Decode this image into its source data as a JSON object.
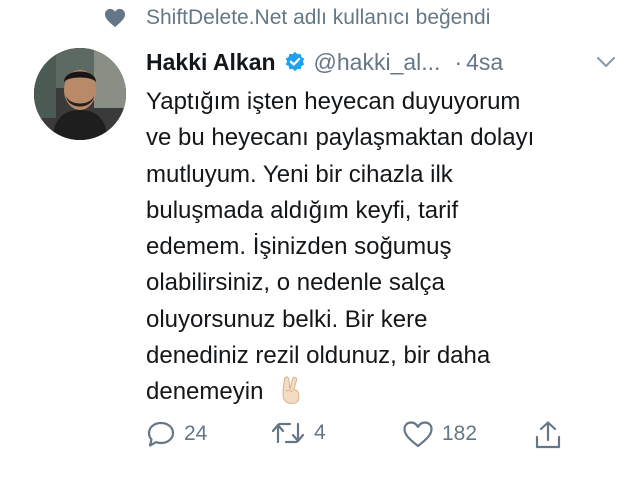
{
  "social_context": {
    "icon": "heart-icon",
    "text": "ShiftDelete.Net adlı kullanıcı beğendi"
  },
  "tweet": {
    "author_name": "Hakki Alkan",
    "handle": "@hakki_al...",
    "separator": "·",
    "time": "4sa",
    "verified": true,
    "text_lines": [
      "Yaptığım işten heyecan duyuyorum",
      "ve bu heyecanı paylaşmaktan dolayı",
      "mutluyum. Yeni bir cihazla ilk",
      "buluşmada aldığım keyfi, tarif",
      "edemem. İşinizden soğumuş",
      "olabilirsiniz, o nedenle salça",
      "oluyorsunuz belki. Bir kere",
      "denediniz rezil oldunuz, bir daha",
      "denemeyin"
    ],
    "emoji": "victory-hand-emoji"
  },
  "actions": {
    "reply_count": "24",
    "retweet_count": "4",
    "like_count": "182"
  },
  "colors": {
    "secondary_text": "#657786",
    "verified_blue": "#1da1f2",
    "body_text": "#14171a"
  }
}
